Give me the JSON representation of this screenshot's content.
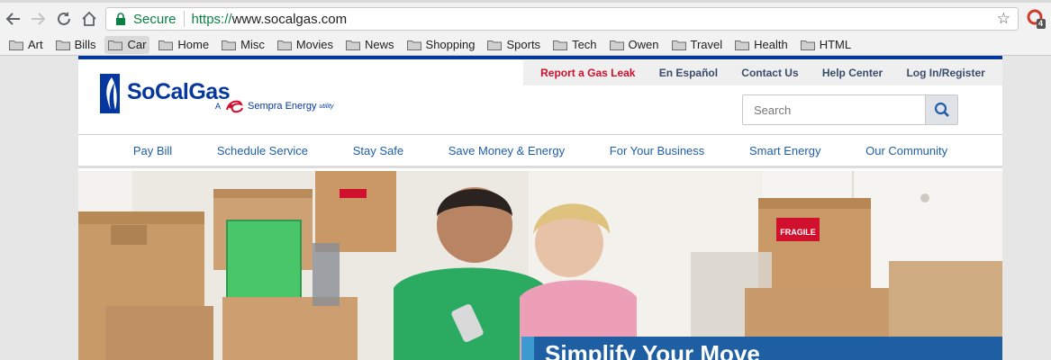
{
  "browser": {
    "secure_label": "Secure",
    "url_scheme": "https://",
    "url_rest": "www.socalgas.com",
    "extension_badge": "4"
  },
  "bookmarks": [
    "Art",
    "Bills",
    "Car",
    "Home",
    "Misc",
    "Movies",
    "News",
    "Shopping",
    "Sports",
    "Tech",
    "Owen",
    "Travel",
    "Health",
    "HTML"
  ],
  "site": {
    "logo_text": "SoCalGas",
    "logo_a": "A",
    "logo_sempra": "Sempra Energy",
    "logo_utility": "utility",
    "utility_links": {
      "gas_leak": "Report a Gas Leak",
      "espanol": "En Español",
      "contact": "Contact Us",
      "help": "Help Center",
      "login": "Log In/Register"
    },
    "search_placeholder": "Search",
    "nav": [
      "Pay Bill",
      "Schedule Service",
      "Stay Safe",
      "Save Money & Energy",
      "For Your Business",
      "Smart Energy",
      "Our Community"
    ],
    "hero_label": "FRAGILE",
    "promo_title": "Simplify Your Move"
  },
  "colors": {
    "brand_blue": "#06379f",
    "gas_leak_red": "#d0102d",
    "secure_green": "#0b8043",
    "nav_link": "#1f5ea8",
    "promo_blue": "#1e5fa3"
  }
}
